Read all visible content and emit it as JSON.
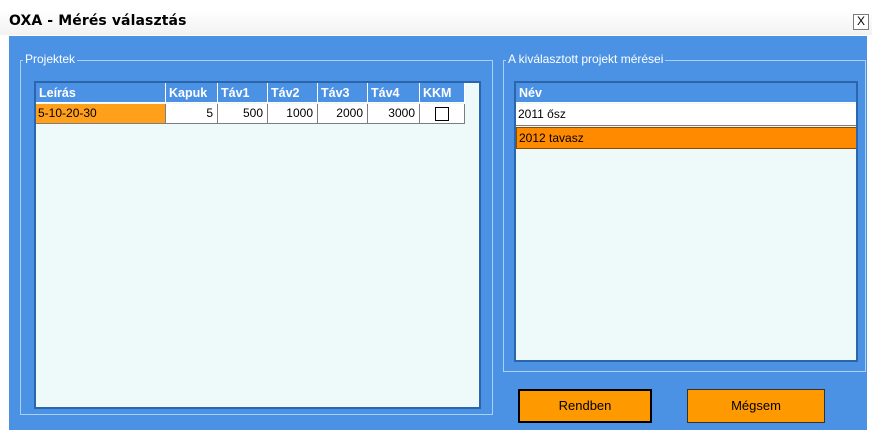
{
  "window": {
    "title": "OXA - Mérés választás",
    "close_label": "X"
  },
  "projects": {
    "group_label": "Projektek",
    "columns": [
      "Leírás",
      "Kapuk",
      "Táv1",
      "Táv2",
      "Táv3",
      "Táv4",
      "KKM"
    ],
    "rows": [
      {
        "leiras": "5-10-20-30",
        "kapuk": "5",
        "tav1": "500",
        "tav2": "1000",
        "tav3": "2000",
        "tav4": "3000",
        "kkm": false
      }
    ]
  },
  "measurements": {
    "group_label": "A kiválasztott projekt mérései",
    "column": "Név",
    "rows": [
      "2011 ősz",
      "2012 tavasz"
    ],
    "selected_index": 1
  },
  "buttons": {
    "ok": "Rendben",
    "cancel": "Mégsem"
  },
  "colors": {
    "client_bg": "#4c92e4",
    "grid_bg": "#eefafa",
    "selection": "#ff8a00",
    "button": "#ff9900"
  }
}
